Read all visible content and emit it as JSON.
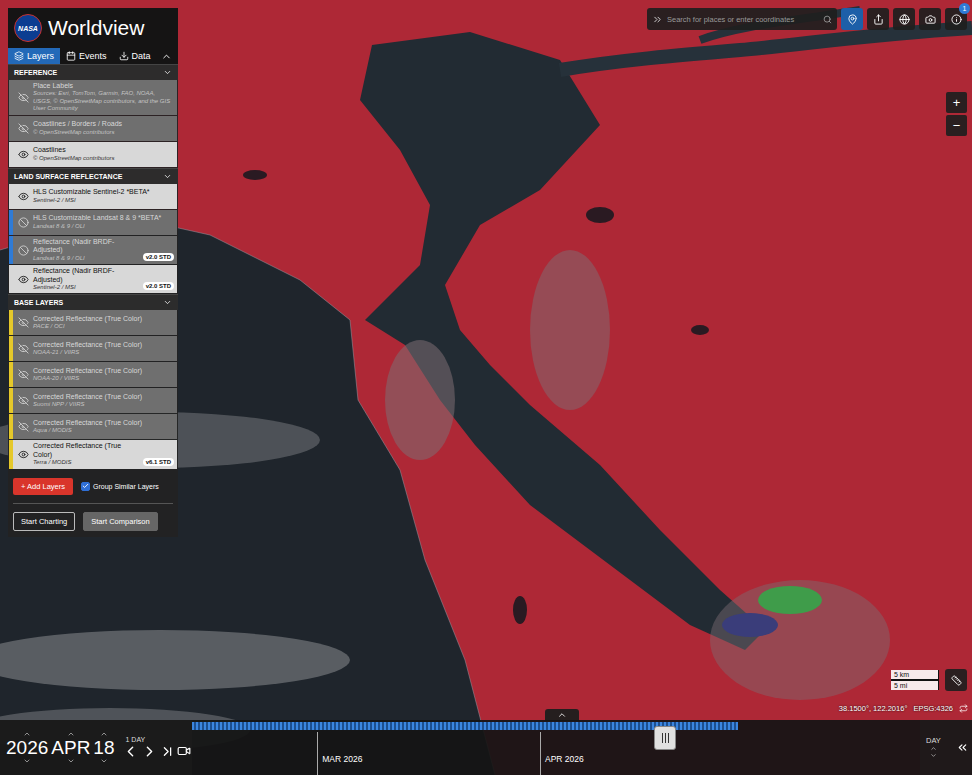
{
  "app": {
    "title": "Worldview",
    "logo": "NASA"
  },
  "tabs": [
    {
      "label": "Layers",
      "selected": true
    },
    {
      "label": "Events",
      "selected": false
    },
    {
      "label": "Data",
      "selected": false
    }
  ],
  "layer_groups": [
    {
      "title": "REFERENCE",
      "layers": [
        {
          "name": "Place Labels",
          "source": "Sources: Esri, TomTom, Garmin, FAO, NOAA, USGS, © OpenStreetMap contributors, and the GIS User Community",
          "visible": false,
          "available": true
        },
        {
          "name": "Coastlines / Borders / Roads",
          "source": "© OpenStreetMap contributors",
          "visible": false,
          "available": true
        },
        {
          "name": "Coastlines",
          "source": "© OpenStreetMap contributors",
          "visible": true,
          "available": true
        }
      ]
    },
    {
      "title": "LAND SURFACE REFLECTANCE",
      "layers": [
        {
          "name": "HLS Customizable Sentinel-2 *BETA*",
          "source": "Sentinel-2 / MSI",
          "visible": true,
          "available": true
        },
        {
          "name": "HLS Customizable Landsat 8 & 9 *BETA*",
          "source": "Landsat 8 & 9 / OLI",
          "visible": false,
          "available": false,
          "color": "#2f7bd6"
        },
        {
          "name": "Reflectance (Nadir BRDF-Adjusted)",
          "source": "Landsat 8 & 9 / OLI",
          "visible": false,
          "available": false,
          "color": "#2f7bd6",
          "badge": "v2.0 STD"
        },
        {
          "name": "Reflectance (Nadir BRDF-Adjusted)",
          "source": "Sentinel-2 / MSI",
          "visible": true,
          "available": true,
          "badge": "v2.0 STD"
        }
      ]
    },
    {
      "title": "BASE LAYERS",
      "layers": [
        {
          "name": "Corrected Reflectance (True Color)",
          "source": "PACE / OCI",
          "visible": false,
          "available": true,
          "color": "#e5c82a"
        },
        {
          "name": "Corrected Reflectance (True Color)",
          "source": "NOAA-21 / VIIRS",
          "visible": false,
          "available": true,
          "color": "#e5c82a"
        },
        {
          "name": "Corrected Reflectance (True Color)",
          "source": "NOAA-20 / VIIRS",
          "visible": false,
          "available": true,
          "color": "#e5c82a"
        },
        {
          "name": "Corrected Reflectance (True Color)",
          "source": "Suomi NPP / VIIRS",
          "visible": false,
          "available": true,
          "color": "#e5c82a"
        },
        {
          "name": "Corrected Reflectance (True Color)",
          "source": "Aqua / MODIS",
          "visible": false,
          "available": true,
          "color": "#e5c82a"
        },
        {
          "name": "Corrected Reflectance (True Color)",
          "source": "Terra / MODIS",
          "visible": true,
          "available": true,
          "color": "#e5c82a",
          "badge": "v6.1 STD"
        }
      ]
    }
  ],
  "add_layers": "+ Add Layers",
  "group_similar": {
    "label": "Group Similar Layers",
    "checked": true
  },
  "panel_buttons": [
    {
      "label": "Start Charting",
      "kind": "outline"
    },
    {
      "label": "Start Comparison",
      "kind": "filled"
    }
  ],
  "search": {
    "placeholder": "Search for places or enter coordinates"
  },
  "notifications": {
    "count": "1"
  },
  "zoom": [
    "+",
    "−"
  ],
  "scale": {
    "metric": "5 km",
    "imperial": "5 mi"
  },
  "coordinates": {
    "position": "38.1500°, 122.2016°",
    "projection": "EPSG:4326"
  },
  "date": {
    "year": "2026",
    "month": "APR",
    "day": "18",
    "step": "1 DAY"
  },
  "timeline": {
    "months": [
      "MAR 2026",
      "APR 2026"
    ],
    "coverage": 0.75,
    "level": 0.65,
    "zoom_level": "DAY"
  }
}
